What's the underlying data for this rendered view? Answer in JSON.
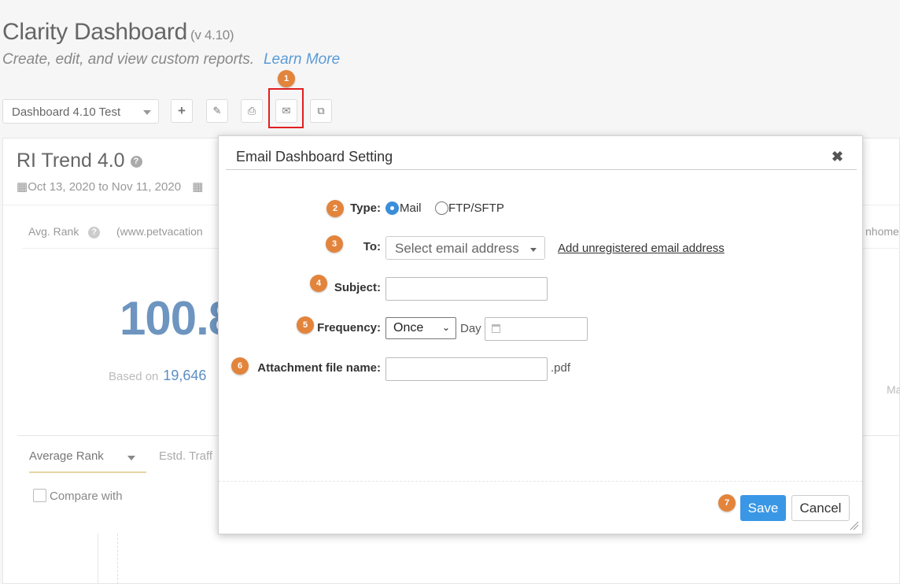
{
  "header": {
    "title": "Clarity Dashboard",
    "version": "(v 4.10)",
    "subtitle": "Create, edit, and view custom reports.",
    "learn_more": "Learn More"
  },
  "toolbar": {
    "dashboard_select": "Dashboard 4.10 Test",
    "buttons": {
      "add": "+",
      "edit": "✎",
      "print": "⎙",
      "email": "✉",
      "copy": "⧉"
    }
  },
  "background": {
    "card_title": "RI Trend 4.0",
    "date_range": "Oct 13, 2020 to Nov 11, 2020",
    "avg_rank_label": "Avg. Rank",
    "domain_fragment": "(www.petvacation",
    "right_domain_fragment": "nhome",
    "big_value_fragment": "100.8",
    "based_on_label": "Based on",
    "based_on_value": "19,646",
    "right_fragment": "Ma",
    "tab_avg_rank": "Average Rank",
    "tab_estd": "Estd. Traff",
    "compare_label": "Compare with"
  },
  "steps": [
    "1",
    "2",
    "3",
    "4",
    "5",
    "6",
    "7"
  ],
  "modal": {
    "title": "Email Dashboard Setting",
    "close": "✖",
    "type_label": "Type:",
    "type_options": [
      "Mail",
      "FTP/SFTP"
    ],
    "type_selected": "Mail",
    "to_label": "To:",
    "to_placeholder": "Select email address",
    "add_unregistered": "Add unregistered email address",
    "subject_label": "Subject:",
    "subject_value": "",
    "frequency_label": "Frequency:",
    "frequency_value": "Once",
    "day_label": "Day",
    "day_value": "",
    "attachment_label": "Attachment file name:",
    "attachment_value": "",
    "attachment_ext": ".pdf",
    "save_label": "Save",
    "cancel_label": "Cancel"
  },
  "colors": {
    "accent": "#3a97e6",
    "step_badge": "#e3843c",
    "highlight": "#e02020"
  }
}
